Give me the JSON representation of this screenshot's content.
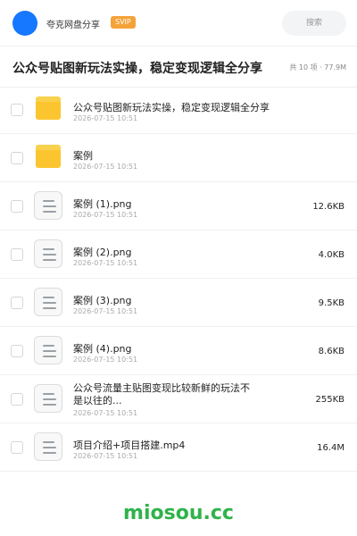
{
  "header": {
    "user_name": "夸克网盘分享",
    "badge": "SVIP",
    "search_placeholder": "搜索"
  },
  "share": {
    "title": "公众号贴图新玩法实操，稳定变现逻辑全分享",
    "meta": "共 10 项 · 77.9M"
  },
  "items": [
    {
      "kind": "folder",
      "name": "公众号贴图新玩法实操，稳定变现逻辑全分享",
      "date": "2026-07-15 10:51",
      "size": ""
    },
    {
      "kind": "folder",
      "name": "案例",
      "date": "2026-07-15 10:51",
      "size": ""
    },
    {
      "kind": "file",
      "name": "案例 (1).png",
      "date": "2026-07-15 10:51",
      "size": "12.6KB"
    },
    {
      "kind": "file",
      "name": "案例 (2).png",
      "date": "2026-07-15 10:51",
      "size": "4.0KB"
    },
    {
      "kind": "file",
      "name": "案例 (3).png",
      "date": "2026-07-15 10:51",
      "size": "9.5KB"
    },
    {
      "kind": "file",
      "name": "案例 (4).png",
      "date": "2026-07-15 10:51",
      "size": "8.6KB"
    },
    {
      "kind": "file",
      "name": "公众号流量主贴图变现比较新鲜的玩法不是以往的...",
      "date": "2026-07-15 10:51",
      "size": "255KB"
    },
    {
      "kind": "file",
      "name": "项目介绍+项目搭建.mp4",
      "date": "2026-07-15 10:51",
      "size": "16.4M"
    }
  ],
  "watermark": "miosou.cc",
  "colors": {
    "avatar": "#1677ff",
    "svip": "#f5a23a",
    "folder": "#fbc52f",
    "watermark": "#2fb34a"
  }
}
